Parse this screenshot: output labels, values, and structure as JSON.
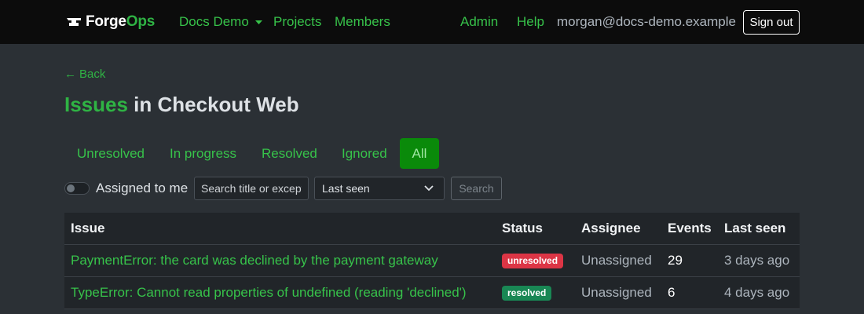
{
  "navbar": {
    "brand_prefix": "Forge",
    "brand_accent": "Ops",
    "org_label": "Docs Demo",
    "links": {
      "projects": "Projects",
      "members": "Members",
      "admin": "Admin",
      "help": "Help"
    },
    "user_email": "morgan@docs-demo.example",
    "signout_label": "Sign out"
  },
  "header": {
    "back_arrow": "←",
    "back_label": "Back",
    "title_accent": "Issues",
    "title_rest": " in Checkout Web"
  },
  "tabs": [
    {
      "label": "Unresolved",
      "active": false
    },
    {
      "label": "In progress",
      "active": false
    },
    {
      "label": "Resolved",
      "active": false
    },
    {
      "label": "Ignored",
      "active": false
    },
    {
      "label": "All",
      "active": true
    }
  ],
  "filters": {
    "assigned_label": "Assigned to me",
    "search_placeholder": "Search title or exception",
    "search_value": "",
    "sort_value": "Last seen",
    "search_button": "Search"
  },
  "table": {
    "headers": {
      "issue": "Issue",
      "status": "Status",
      "assignee": "Assignee",
      "events": "Events",
      "last_seen": "Last seen"
    },
    "rows": [
      {
        "issue": "PaymentError: the card was declined by the payment gateway",
        "status": "unresolved",
        "assignee": "Unassigned",
        "events": "29",
        "last_seen": "3 days ago"
      },
      {
        "issue": "TypeError: Cannot read properties of undefined (reading 'declined')",
        "status": "resolved",
        "assignee": "Unassigned",
        "events": "6",
        "last_seen": "4 days ago"
      }
    ]
  },
  "colors": {
    "accent": "#2fb344",
    "navbar_bg": "#0c0c0c",
    "page_bg": "#2b3035",
    "badge_unresolved": "#dc3545",
    "badge_resolved": "#198754"
  }
}
